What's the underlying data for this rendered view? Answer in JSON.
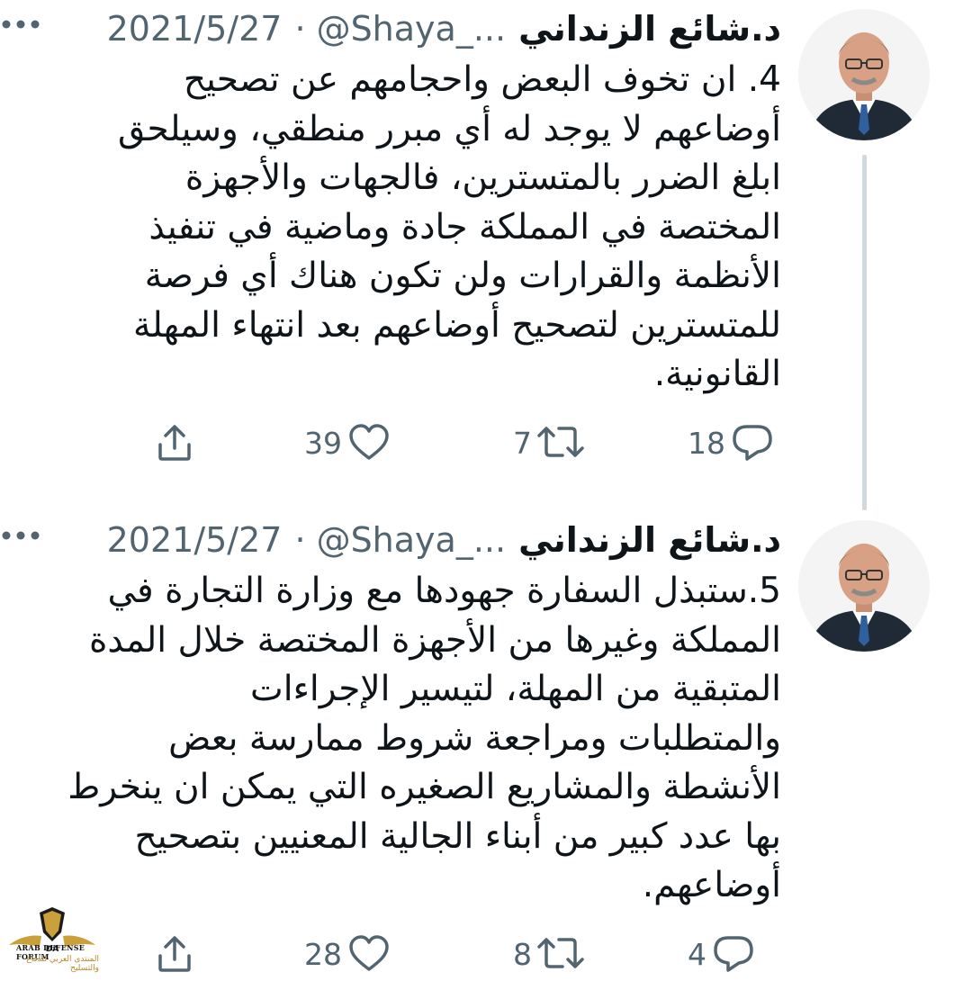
{
  "tweets": [
    {
      "author_name": "د.شائع الزنداني",
      "handle": "@Shaya_...",
      "date": "2021/5/27",
      "separator": "·",
      "text_lines": [
        "4. ان تخوف البعض واحجامهم عن تصحيح",
        "أوضاعهم لا يوجد له أي مبرر منطقي، وسيلحق",
        "ابلغ الضرر بالمتسترين، فالجهات والأجهزة",
        "المختصة في المملكة جادة وماضية في تنفيذ",
        "الأنظمة والقرارات ولن تكون هناك أي فرصة",
        "للمتسترين لتصحيح أوضاعهم بعد انتهاء المهلة",
        "القانونية."
      ],
      "replies": "18",
      "retweets": "7",
      "likes": "39"
    },
    {
      "author_name": "د.شائع الزنداني",
      "handle": "@Shaya_...",
      "date": "2021/5/27",
      "separator": "·",
      "text_lines": [
        "5.ستبذل السفارة جهودها مع وزارة التجارة في",
        "المملكة وغيرها من الأجهزة المختصة خلال المدة",
        "المتبقية من المهلة، لتيسير الإجراءات",
        "والمتطلبات ومراجعة شروط ممارسة بعض",
        "الأنشطة والمشاريع الصغيره التي يمكن ان ينخرط",
        "بها عدد كبير من أبناء الجالية المعنيين بتصحيح",
        "أوضاعهم."
      ],
      "replies": "4",
      "retweets": "8",
      "likes": "28"
    }
  ],
  "watermark": {
    "line1": "ARAB DEFENSE FORUM",
    "line2": "المنتدى العربي للدفاع والتسليح",
    "logo_letters": "DA"
  },
  "icons": {
    "more": "more-dots-icon",
    "reply": "reply-bubble-icon",
    "retweet": "retweet-icon",
    "like": "heart-icon",
    "share": "share-upload-icon"
  },
  "colors": {
    "text": "#0f1419",
    "secondary": "#536471",
    "thread_line": "#cfd9de",
    "watermark_gold": "#b58a2a"
  }
}
